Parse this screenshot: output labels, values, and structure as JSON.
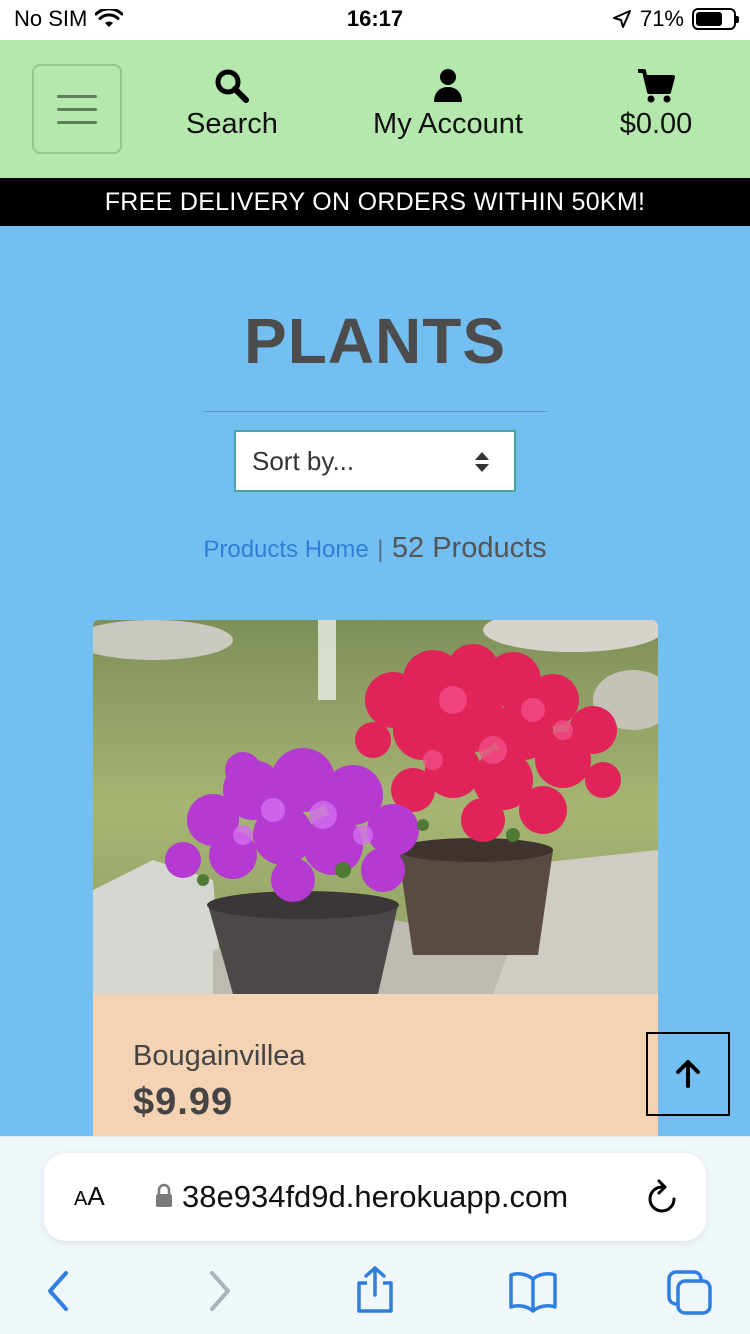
{
  "status": {
    "carrier": "No SIM",
    "time": "16:17",
    "battery": "71%",
    "battery_level": 0.71
  },
  "header": {
    "menu_icon": "hamburger-icon",
    "search_label": "Search",
    "search_icon": "search-icon",
    "account_label": "My Account",
    "account_icon": "user-icon",
    "cart_label": "$0.00",
    "cart_icon": "cart-icon",
    "background": "#b4e8ac"
  },
  "banner": {
    "text": "FREE DELIVERY ON ORDERS WITHIN 50KM!"
  },
  "main": {
    "title": "PLANTS",
    "sort_placeholder": "Sort by...",
    "products_home_link": "Products Home",
    "separator": "|",
    "product_count": "52 Products",
    "background": "#73bff2"
  },
  "products": [
    {
      "name": "Bougainvillea",
      "price": "$9.99",
      "image": "bougainvillea-pots-photo",
      "card_color": "#f4d3b4"
    }
  ],
  "back_to_top_icon": "arrow-up-icon",
  "browser": {
    "aa_label_small": "A",
    "aa_label_large": "A",
    "url": "38e934fd9d.herokuapp.com",
    "icons": [
      "back-icon",
      "forward-icon",
      "share-icon",
      "bookmarks-icon",
      "tabs-icon",
      "reload-icon",
      "lock-icon"
    ]
  }
}
